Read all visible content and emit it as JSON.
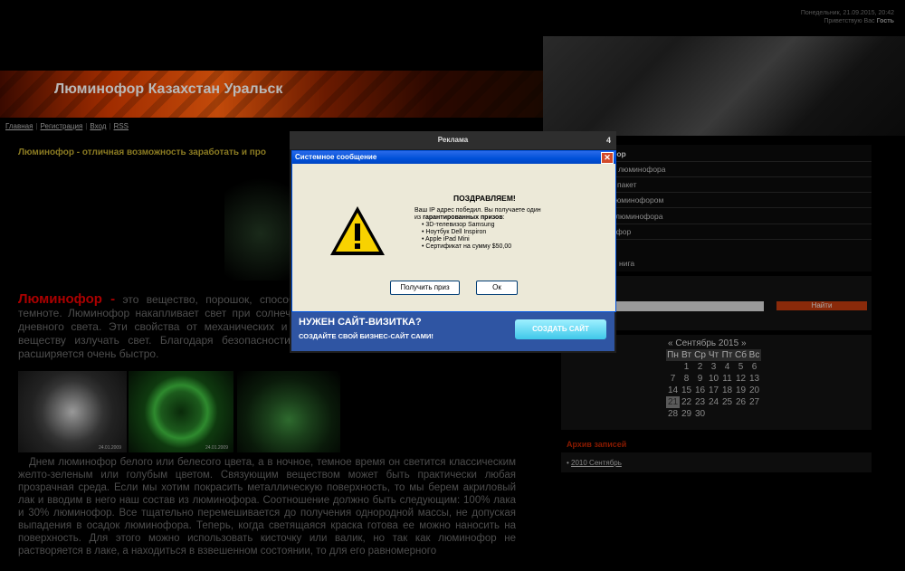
{
  "top_info": {
    "datetime": "Понедельник, 21.09.2015, 20:42",
    "greeting": "Приветствую Вас",
    "user": "Гость"
  },
  "site": {
    "title": "Люминофор Казахстан Уральск"
  },
  "nav": [
    {
      "label": "Главная"
    },
    {
      "label": "Регистрация"
    },
    {
      "label": "Вход"
    },
    {
      "label": "RSS"
    }
  ],
  "main": {
    "headline": "Люминофор - отличная возможность заработать и про",
    "intro_bold": "Люминофор -",
    "intro_text": " это вещество, порошок, способное накапливать энергию и светиться в темноте. Люминофор накапливает свет при солнечном освещении ламп накаливания и ламп дневного света. Эти свойства от механических и температурных воздействий. Связующему веществу излучать свет. Благодаря безопасности этого вещества сфера его применения расширяется очень быстро.",
    "photos": [
      {
        "caption": "24.01.2009"
      },
      {
        "caption": "24.01.2009"
      },
      {
        "caption": ""
      }
    ],
    "body": "Днем люминофор белого или белесого цвета, а в ночное, темное время он светится классическим желто-зеленым или голубым цветом. Связующим веществом может быть практически любая прозрачная среда. Если мы хотим покрасить металлическую поверхность, то мы берем акриловый лак и вводим в него наш состав из люминофора. Соотношение должно быть следующим: 100% лака и 30% люминофор. Все тщательно перемешивается до получения однородной массы, не допуская выпадения в осадок люминофора. Теперь, когда светящаяся краска готова ее можно наносить на поверхность. Для этого можно использовать кисточку или валик, но так как люминофор не растворяется в лаке, а находиться в взвешенном состоянии, то для его равномерного"
  },
  "sidebar": {
    "links": [
      {
        "label": "фор"
      },
      {
        "label": "е люминофора"
      },
      {
        "label": "пакет"
      },
      {
        "label": "юминофором"
      },
      {
        "label": "люминофора"
      },
      {
        "label": "ифор"
      },
      {
        "label": "нига"
      }
    ],
    "search": {
      "value": "",
      "button": "Найти"
    },
    "calendar": {
      "month": "Сентябрь 2015",
      "prev": "«",
      "next": "»",
      "weekdays": [
        "Пн",
        "Вт",
        "Ср",
        "Чт",
        "Пт",
        "Сб",
        "Вс"
      ],
      "rows": [
        [
          "",
          "1",
          "2",
          "3",
          "4",
          "5",
          "6"
        ],
        [
          "7",
          "8",
          "9",
          "10",
          "11",
          "12",
          "13"
        ],
        [
          "14",
          "15",
          "16",
          "17",
          "18",
          "19",
          "20"
        ],
        [
          "21",
          "22",
          "23",
          "24",
          "25",
          "26",
          "27"
        ],
        [
          "28",
          "29",
          "30",
          "",
          "",
          "",
          ""
        ]
      ],
      "today": "21"
    },
    "archive": {
      "title": "Архив записей",
      "link": "2010 Сентябрь"
    }
  },
  "ad": {
    "title": "Реклама",
    "counter": "4",
    "dialog": {
      "title": "Системное сообщение",
      "close": "✕",
      "heading": "ПОЗДРАВЛЯЕМ!",
      "line1": "Ваш IP адрес победил. Вы получаете один",
      "line2_prefix": "из ",
      "line2_bold": "гарантированных призов",
      "line2_suffix": ":",
      "prizes": [
        "3D-телевизор Samsung",
        "Ноутбук Dell Inspiron",
        "Apple iPad Mini",
        "Сертификат на сумму $50,00"
      ],
      "btn_prize": "Получить приз",
      "btn_ok": "Ок"
    },
    "promo": {
      "title": "НУЖЕН САЙТ-ВИЗИТКА?",
      "subtitle": "СОЗДАЙТЕ СВОЙ БИЗНЕС-САЙТ САМИ!",
      "button": "СОЗДАТЬ САЙТ"
    }
  },
  "colors": {
    "accent_red": "#a00000",
    "dialog_bg": "#ece9d8",
    "promo_bg": "#2f55a3",
    "xp_title": "#0050d8"
  },
  "icons": {
    "warning": "warning-icon",
    "close": "close-icon"
  }
}
